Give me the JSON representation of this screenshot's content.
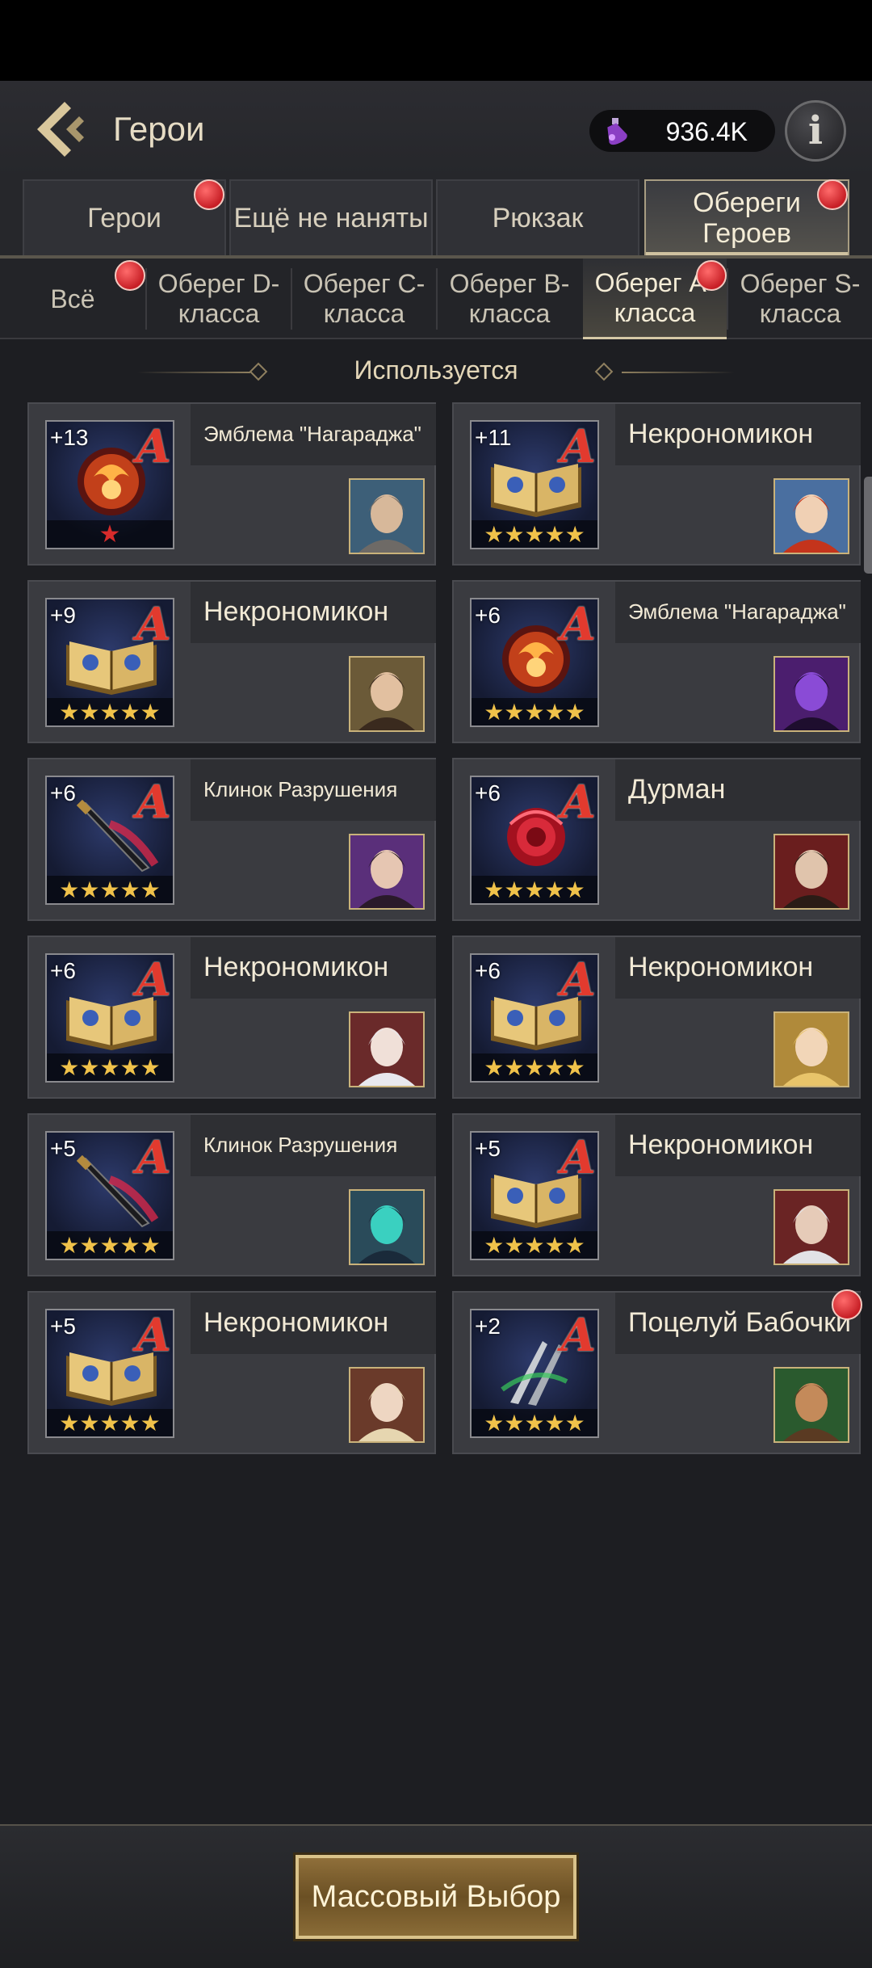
{
  "header": {
    "title": "Герои",
    "currency_amount": "936.4K"
  },
  "tabs": [
    {
      "label": "Герои",
      "badge": true
    },
    {
      "label": "Ещё не наняты",
      "badge": false
    },
    {
      "label": "Рюкзак",
      "badge": false
    },
    {
      "label": "Обереги Героев",
      "badge": true,
      "active": true
    }
  ],
  "subtabs": [
    {
      "label": "Всё",
      "badge": true
    },
    {
      "label": "Оберег D-класса"
    },
    {
      "label": "Оберег C-класса"
    },
    {
      "label": "Оберег B-класса"
    },
    {
      "label": "Оберег A-класса",
      "badge": true,
      "active": true
    },
    {
      "label": "Оберег S-класса"
    }
  ],
  "section_title": "Используется",
  "cards": [
    {
      "name": "Эмблема \"Нагараджа\"",
      "level": "+13",
      "grade": "A",
      "stars": "★",
      "item": "emblem"
    },
    {
      "name": "Некрономикон",
      "level": "+11",
      "grade": "A",
      "stars": "★★★★★",
      "item": "book"
    },
    {
      "name": "Некрономикон",
      "level": "+9",
      "grade": "A",
      "stars": "★★★★★",
      "item": "book"
    },
    {
      "name": "Эмблема \"Нагараджа\"",
      "level": "+6",
      "grade": "A",
      "stars": "★★★★★",
      "item": "emblem"
    },
    {
      "name": "Клинок Разрушения",
      "level": "+6",
      "grade": "A",
      "stars": "★★★★★",
      "item": "blade"
    },
    {
      "name": "Дурман",
      "level": "+6",
      "grade": "A",
      "stars": "★★★★★",
      "item": "rose"
    },
    {
      "name": "Некрономикон",
      "level": "+6",
      "grade": "A",
      "stars": "★★★★★",
      "item": "book"
    },
    {
      "name": "Некрономикон",
      "level": "+6",
      "grade": "A",
      "stars": "★★★★★",
      "item": "book"
    },
    {
      "name": "Клинок Разрушения",
      "level": "+5",
      "grade": "A",
      "stars": "★★★★★",
      "item": "blade"
    },
    {
      "name": "Некрономикон",
      "level": "+5",
      "grade": "A",
      "stars": "★★★★★",
      "item": "book"
    },
    {
      "name": "Некрономикон",
      "level": "+5",
      "grade": "A",
      "stars": "★★★★★",
      "item": "book"
    },
    {
      "name": "Поцелуй Бабочки",
      "level": "+2",
      "grade": "A",
      "stars": "★★★★★",
      "item": "claws",
      "badge": true
    }
  ],
  "footer": {
    "button_label": "Массовый Выбор"
  },
  "colors": {
    "background": "#1d1e22",
    "card": "#3a3b40",
    "accent_gold": "#d9c28a",
    "badge_red": "#c71f26",
    "grade_red": "#e23a2e",
    "star_gold": "#f0c24a"
  }
}
